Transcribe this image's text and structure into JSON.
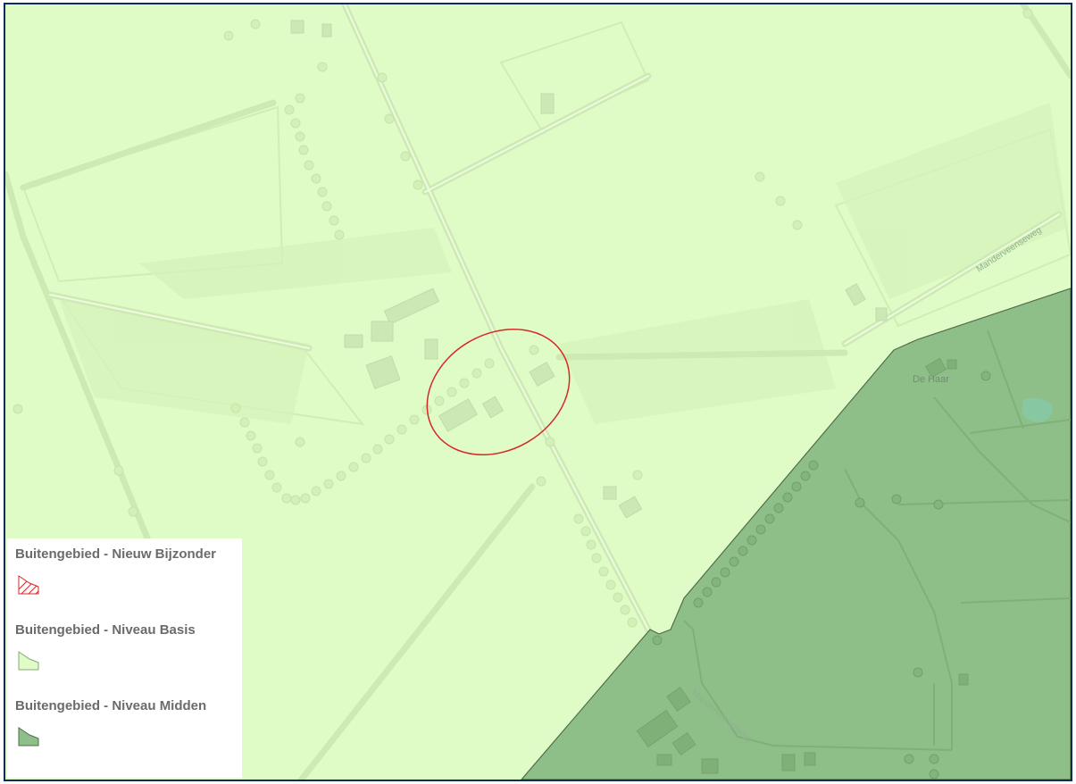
{
  "map": {
    "place_labels": [
      "De Haar",
      "Manderveenseweg",
      "Manderveenseweg"
    ]
  },
  "legend": {
    "items": [
      {
        "title": "Buitengebied - Nieuw Bijzonder",
        "icon": "hatched-polygon-icon",
        "stroke_color": "#d62828",
        "fill_color": "#ffffff"
      },
      {
        "title": "Buitengebied - Niveau Basis",
        "icon": "light-green-polygon-icon",
        "stroke_color": "#8aa57c",
        "fill_color": "#dffcc6"
      },
      {
        "title": "Buitengebied - Niveau Midden",
        "icon": "dark-green-polygon-icon",
        "stroke_color": "#4f6f4a",
        "fill_color": "#8fbf88"
      }
    ]
  },
  "colors": {
    "niveau_basis": "#dffcc6",
    "niveau_midden": "#8fbf88",
    "highlight_ellipse": "#d62828",
    "frame_border": "#0f2a5c"
  }
}
